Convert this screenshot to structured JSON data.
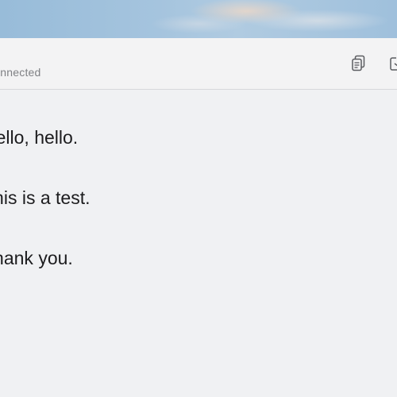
{
  "toolbar": {
    "status_text": "Connected",
    "copy_icon": "copy-icon",
    "export_icon": "export-icon"
  },
  "transcript": {
    "lines": [
      "Hello, hello.",
      "This is a test.",
      "Thank you."
    ]
  }
}
